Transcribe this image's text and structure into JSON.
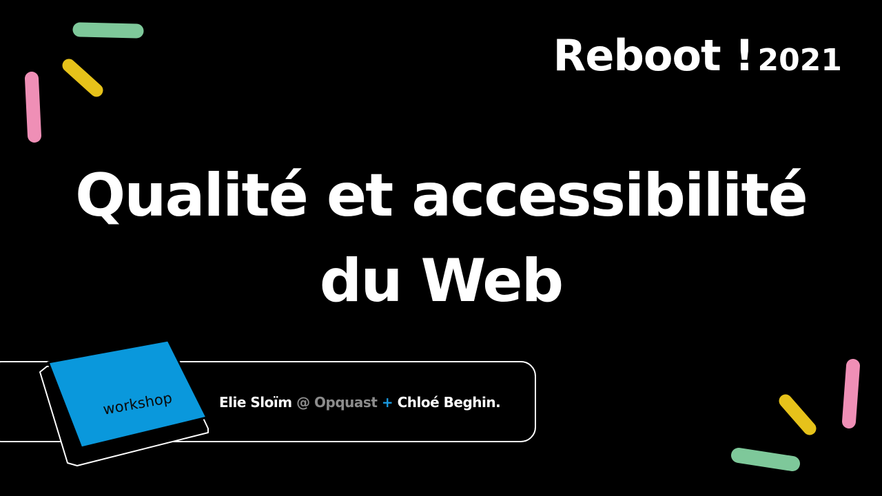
{
  "brand": {
    "name": "Reboot !",
    "year": "2021"
  },
  "title": {
    "line1": "Qualité et accessibilité",
    "line2": "du Web"
  },
  "badge": {
    "label": "workshop",
    "color": "#0a98dc"
  },
  "speakers": {
    "name1": "Elie Sloïm",
    "at": "@",
    "org": "Opquast",
    "plus": "+",
    "name2": "Chloé Beghin."
  },
  "colors": {
    "background": "#000000",
    "text": "#ffffff",
    "accent_blue": "#1a9ae0",
    "green": "#7ec89a",
    "yellow": "#e6c21a",
    "pink": "#ef8fb6",
    "grey": "#8c8c8c"
  }
}
